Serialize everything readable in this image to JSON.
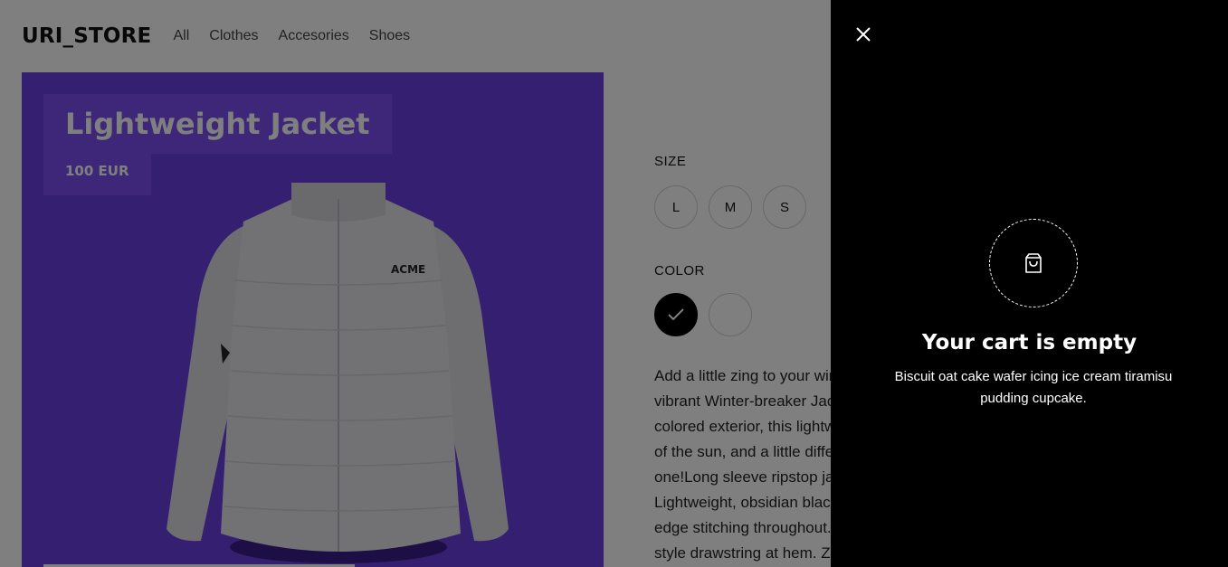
{
  "store": {
    "logo": "URI_STORE",
    "nav": [
      "All",
      "Clothes",
      "Accesories",
      "Shoes"
    ]
  },
  "product": {
    "title": "Lightweight Jacket",
    "price": "100 EUR",
    "jacket_brand": "ACME",
    "hero_color": "#6b3fe0",
    "size_label": "SIZE",
    "sizes": [
      "L",
      "M",
      "S"
    ],
    "color_label": "COLOR",
    "colors": [
      {
        "name": "black",
        "hex": "#000000",
        "selected": true
      },
      {
        "name": "white",
        "hex": "#ffffff",
        "selected": false
      }
    ],
    "description": "Add a little zing to your winter wardrobe with this vibrant Winter-breaker Jacket. With a brilliantly colored exterior, this lightweight jacket is just the stuff of the sun, and a little different to the regular one!Long sleeve ripstop jacket in colorblock style. Lightweight, obsidian black and brown ripstop. Raw-edge stitching throughout. Logo-woven. Bungee-style drawstring at hem. Zip closure at front. Bubbl"
  },
  "cart": {
    "title": "Your cart is empty",
    "message": "Biscuit oat cake wafer icing ice cream tiramisu pudding cupcake.",
    "close_icon": "close-icon",
    "bag_icon": "shopping-bag-icon"
  }
}
